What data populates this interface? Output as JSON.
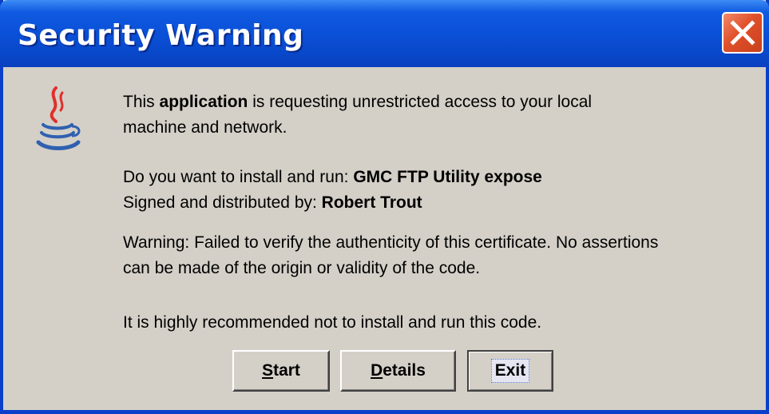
{
  "window": {
    "title": "Security Warning"
  },
  "message": {
    "line1_pre": "This ",
    "line1_bold": "application",
    "line1_post": " is requesting unrestricted access to your local",
    "line2": "machine and network.",
    "install_label": "Do you want to install and run: ",
    "install_name": "GMC FTP Utility expose",
    "signed_label": "Signed and distributed by: ",
    "signed_name": "Robert Trout",
    "warning_line1": "Warning: Failed to verify the authenticity of this certificate. No assertions",
    "warning_line2": "can be made of the origin or validity of the code.",
    "recommendation": "It is highly recommended not to install and run this code."
  },
  "buttons": {
    "start_mnemonic": "S",
    "start_rest": "tart",
    "details_mnemonic": "D",
    "details_rest": "etails",
    "exit_label": "Exit"
  },
  "icons": {
    "close": "close-icon",
    "java": "java-cup-icon"
  },
  "colors": {
    "titlebar": "#0a4fd6",
    "close_button": "#e0502a",
    "dialog_background": "#d4d0c8"
  }
}
